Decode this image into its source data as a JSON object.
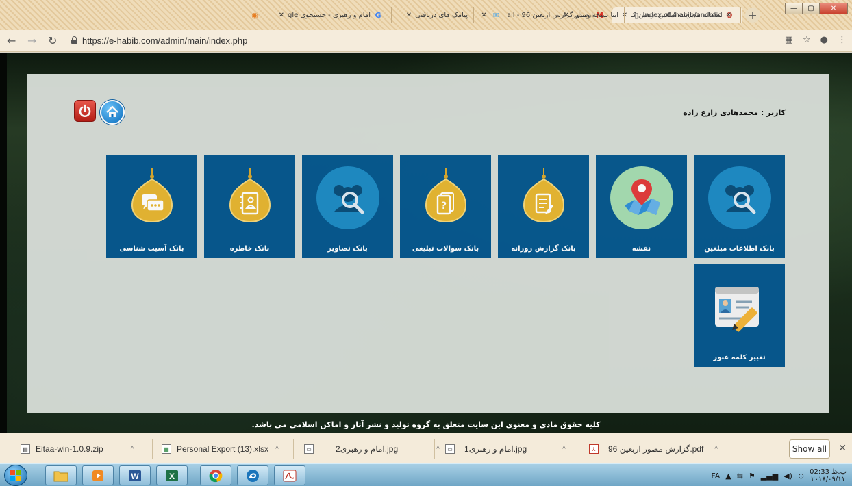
{
  "browser": {
    "tabs": [
      {
        "title": "سامانه مدیریت مبلغین اربعین کـ",
        "active": true,
        "favicon": "site-icon"
      },
      {
        "title": "ارسال گزارش اربعین 96 - ail",
        "active": false,
        "favicon": "gmail-icon"
      },
      {
        "title": "",
        "active": false,
        "favicon": "mail-icon"
      },
      {
        "title": "پیامک های دریافتی",
        "active": false,
        "favicon": ""
      },
      {
        "title": "امام و رهبری - جستجوی gle",
        "active": false,
        "favicon": "google-icon"
      },
      {
        "title": "",
        "active": false,
        "favicon": "site-icon"
      },
      {
        "title": "ایتا نسخه ویندوز",
        "active": false,
        "favicon": ""
      },
      {
        "title": "Index of /habib/android",
        "active": false,
        "favicon": "page-icon"
      }
    ],
    "url": "https://e-habib.com/admin/main/index.php"
  },
  "page": {
    "user_label": "کاربر : محمدهادی زارع زاده",
    "tiles": [
      {
        "label": "بانک اطلاعات مبلغین",
        "icon": "people-search-icon"
      },
      {
        "label": "نقشه",
        "icon": "map-pin-icon"
      },
      {
        "label": "بانک گزارش روزانه",
        "icon": "report-icon"
      },
      {
        "label": "بانک سوالات تبلیغی",
        "icon": "question-icon"
      },
      {
        "label": "بانک تصاویر",
        "icon": "people-search-icon"
      },
      {
        "label": "بانک خاطره",
        "icon": "notebook-icon"
      },
      {
        "label": "بانک آسیب شناسی",
        "icon": "chat-icon"
      },
      {
        "label": "تغییر کلمه عبور",
        "icon": "id-card-pencil-icon"
      }
    ],
    "footer": "کلیه حقوق مادی و معنوی این سایت متعلق به گروه تولید و نشر آثار و اماکن اسلامی می باشد."
  },
  "downloads": {
    "items": [
      {
        "name": "Eitaa-win-1.0.9.zip"
      },
      {
        "name": "Personal Export (13).xlsx"
      },
      {
        "name": "امام و رهبری2.jpg"
      },
      {
        "name": "امام و رهبری1.jpg"
      },
      {
        "name": "گزارش مصور اربعین 96.pdf"
      }
    ],
    "show_all": "Show all"
  },
  "taskbar": {
    "lang": "FA",
    "time": "02:33 ب.ظ",
    "date": "۲۰۱۸/۰۹/۱۱"
  }
}
